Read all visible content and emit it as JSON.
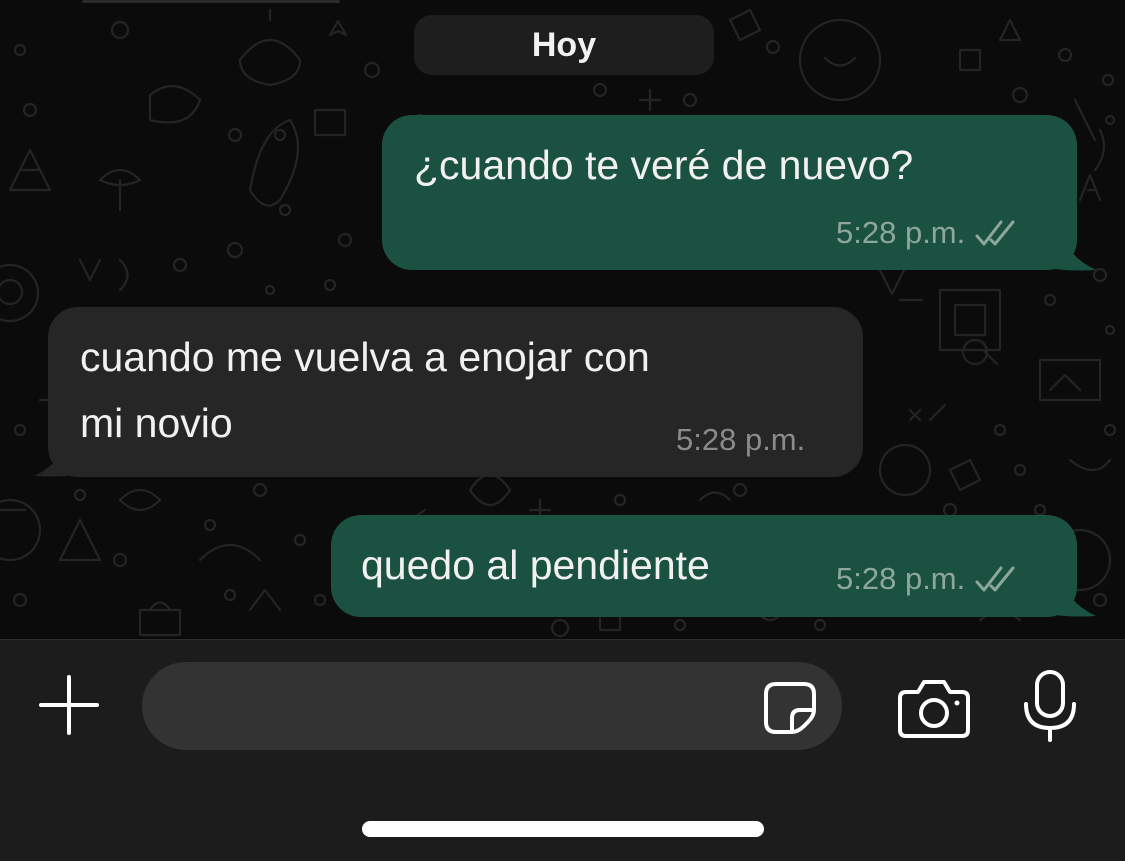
{
  "date_separator": "Hoy",
  "messages": [
    {
      "direction": "outgoing",
      "lines": [
        "¿cuando te veré de nuevo?"
      ],
      "time": "5:28 p.m.",
      "status_icon": "double-check-icon"
    },
    {
      "direction": "incoming",
      "lines": [
        "cuando me vuelva a enojar con",
        "mi novio"
      ],
      "time": "5:28 p.m."
    },
    {
      "direction": "outgoing",
      "lines": [
        "quedo al pendiente"
      ],
      "time": "5:28 p.m.",
      "status_icon": "double-check-icon"
    }
  ],
  "composer": {
    "input_value": "",
    "icons": [
      "plus-icon",
      "sticker-icon",
      "camera-icon",
      "microphone-icon"
    ]
  },
  "colors": {
    "chat_background": "#0b0b0b",
    "outgoing_bubble": "#1a5140",
    "incoming_bubble": "#262626",
    "composer_background": "#1c1c1c",
    "input_background": "#333333"
  }
}
